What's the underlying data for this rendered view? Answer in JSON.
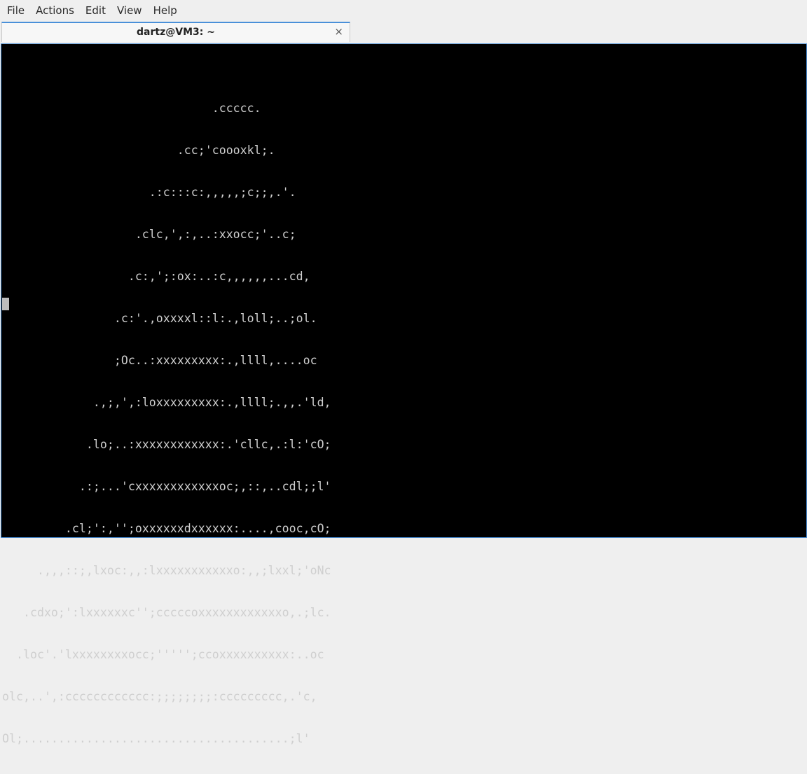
{
  "menu": {
    "file": "File",
    "actions": "Actions",
    "edit": "Edit",
    "view": "View",
    "help": "Help"
  },
  "tab": {
    "title": "dartz@VM3: ~",
    "close_icon": "×"
  },
  "terminal": {
    "lines": [
      "                              .ccccc.",
      "                         .cc;'coooxkl;.",
      "                     .:c:::c:,,,,,;c;;,.'.",
      "                   .clc,',:,..:xxocc;'..c;",
      "                  .c:,';:ox:..:c,,,,,,...cd,",
      "                .c:'.,oxxxxl::l:.,loll;..;ol.",
      "                ;Oc..:xxxxxxxxx:.,llll,....oc",
      "             .,;,',:loxxxxxxxxx:.,llll;.,,.'ld,",
      "            .lo;..:xxxxxxxxxxxx:.'cllc,.:l:'cO;",
      "           .:;...'cxxxxxxxxxxxxoc;,::,..cdl;;l'",
      "         .cl;':,'';oxxxxxxdxxxxxx:....,cooc,cO;",
      "     .,,,::;,lxoc:,,:lxxxxxxxxxxxo:,,;lxxl;'oNc",
      "   .cdxo;':lxxxxxxc'';cccccoxxxxxxxxxxxxo,.;lc.",
      "  .loc'.'lxxxxxxxxocc;''''';ccoxxxxxxxxxx:..oc",
      "olc,..',:cccccccccccc:;;;;;;;;:ccccccccc,.'c,",
      "Ol;......................................;l'"
    ]
  }
}
